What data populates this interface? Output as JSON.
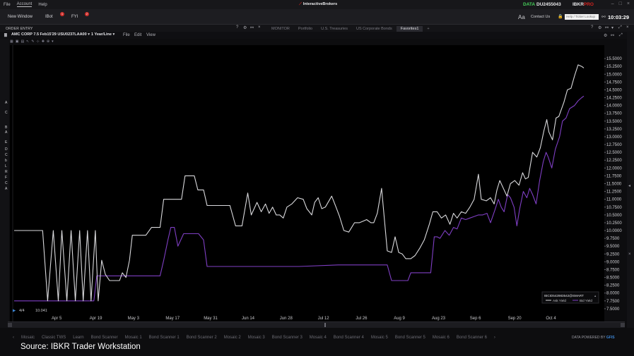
{
  "menu": {
    "items": [
      "File",
      "Account",
      "Help"
    ],
    "active_index": 1
  },
  "brand": "InteractiveBrokers",
  "toolbar": {
    "new_window": "New Window",
    "ibot": "IBot",
    "ibot_badge": "1",
    "fyi": "FYI",
    "fyi_badge": "2",
    "data_label": "DATA",
    "account_id": "DU2455043",
    "ibkr": "IBKR",
    "ibkr_pro": "PRO",
    "font_size_glyph": "Aa",
    "contact": "Contact Us",
    "lookup_placeholder": "Help / Ticker Lookup",
    "clock": "10:03:29"
  },
  "panel": {
    "order_entry": "ORDER ENTRY",
    "tabs": [
      "MONITOR",
      "Portfolio",
      "U.S. Treasuries",
      "US Corporate Bonds",
      "Favorites1"
    ],
    "selected_tab": 4,
    "add_tab": "+"
  },
  "chart_header": {
    "symbol": "AMC CORP 7.5 Feb15'29 USU0237LAA00",
    "period": "1 Year/Line",
    "menus": [
      "File",
      "Edit",
      "View"
    ]
  },
  "left_letters": [
    "A",
    "C",
    "B",
    "A",
    "E",
    "D",
    "C",
    "b",
    "L",
    "R",
    "F",
    "C",
    "A"
  ],
  "bottom_tabs": [
    "Mosaic",
    "Classic TWS",
    "Learn",
    "Bond Scanner",
    "Mosaic 1",
    "Bond Scanner 1",
    "Bond Scanner 2",
    "Mosaic 2",
    "Mosaic 3",
    "Bond Scanner 3",
    "Mosaic 4",
    "Bond Scanner 4",
    "Mosaic 5",
    "Bond Scanner 5",
    "Mosaic 6",
    "Bond Scanner 6"
  ],
  "powered_by": "DATA POWERED BY",
  "powered_brand": "GFIS",
  "source": "Source: IBKR Trader Workstation",
  "colors": {
    "ask": "#d9d9dc",
    "bid": "#7f3fc4",
    "background": "#000000",
    "accent": "#d3231f"
  },
  "chart_data": {
    "type": "line",
    "x_ticks": [
      "Apr 5",
      "Apr 19",
      "May 3",
      "May 17",
      "May 31",
      "Jun 14",
      "Jun 28",
      "Jul 12",
      "Jul 26",
      "Aug 9",
      "Aug 23",
      "Sep 6",
      "Sep 20",
      "Oct 4"
    ],
    "ylim": [
      7.25,
      15.75
    ],
    "y_ticks": [
      "7.5000",
      "7.7500",
      "8.0000",
      "8.2500",
      "8.5000",
      "8.7500",
      "9.0000",
      "9.2500",
      "9.5000",
      "9.7500",
      "10.0000",
      "10.2500",
      "10.5000",
      "10.7500",
      "11.0000",
      "11.2500",
      "11.5000",
      "11.7500",
      "12.0000",
      "12.2500",
      "12.5000",
      "12.7500",
      "13.0000",
      "13.2500",
      "13.5000",
      "13.7500",
      "14.0000",
      "14.2500",
      "14.5000",
      "14.7500",
      "15.0000",
      "15.2500",
      "15.5000"
    ],
    "cursor_readout": {
      "date": "4/4",
      "value": "10.041"
    },
    "instrument_label": "IBCID542983542@SMART",
    "series": [
      {
        "name": "Ask Yield",
        "color": "#d9d9dc",
        "points": [
          [
            0,
            10.0
          ],
          [
            40,
            10.0
          ],
          [
            47,
            7.75
          ],
          [
            55,
            10.0
          ],
          [
            62,
            7.75
          ],
          [
            67,
            10.0
          ],
          [
            74,
            7.75
          ],
          [
            80,
            10.0
          ],
          [
            86,
            7.75
          ],
          [
            92,
            10.0
          ],
          [
            97,
            7.75
          ],
          [
            103,
            10.0
          ],
          [
            108,
            7.75
          ],
          [
            114,
            10.0
          ],
          [
            118,
            7.75
          ],
          [
            123,
            9.05
          ],
          [
            128,
            8.6
          ],
          [
            134,
            8.4
          ],
          [
            148,
            8.4
          ],
          [
            152,
            8.65
          ],
          [
            157,
            8.5
          ],
          [
            162,
            9.05
          ],
          [
            166,
            9.85
          ],
          [
            185,
            9.85
          ],
          [
            193,
            10.1
          ],
          [
            205,
            10.1
          ],
          [
            210,
            11.0
          ],
          [
            226,
            11.0
          ],
          [
            235,
            11.0
          ],
          [
            240,
            11.75
          ],
          [
            253,
            11.75
          ],
          [
            258,
            11.3
          ],
          [
            266,
            11.3
          ],
          [
            271,
            10.8
          ],
          [
            303,
            10.8
          ],
          [
            311,
            10.15
          ],
          [
            320,
            10.15
          ],
          [
            328,
            11.2
          ],
          [
            333,
            10.5
          ],
          [
            341,
            10.9
          ],
          [
            347,
            10.6
          ],
          [
            353,
            10.85
          ],
          [
            358,
            10.55
          ],
          [
            363,
            10.75
          ],
          [
            368,
            10.5
          ],
          [
            373,
            10.5
          ],
          [
            378,
            10.4
          ],
          [
            383,
            10.75
          ],
          [
            390,
            10.85
          ],
          [
            398,
            11.05
          ],
          [
            406,
            11.0
          ],
          [
            411,
            10.7
          ],
          [
            418,
            10.5
          ],
          [
            422,
            10.9
          ],
          [
            427,
            11.05
          ],
          [
            432,
            10.7
          ],
          [
            437,
            10.75
          ],
          [
            446,
            11.1
          ],
          [
            452,
            10.75
          ],
          [
            457,
            10.45
          ],
          [
            463,
            10.0
          ],
          [
            470,
            9.95
          ],
          [
            478,
            10.25
          ],
          [
            485,
            10.25
          ],
          [
            490,
            10.3
          ],
          [
            495,
            10.35
          ],
          [
            501,
            10.25
          ],
          [
            505,
            10.25
          ],
          [
            510,
            10.55
          ],
          [
            516,
            11.35
          ],
          [
            524,
            9.35
          ],
          [
            530,
            9.3
          ],
          [
            535,
            9.8
          ],
          [
            540,
            9.3
          ],
          [
            545,
            9.25
          ],
          [
            550,
            9.1
          ],
          [
            557,
            9.1
          ],
          [
            563,
            9.2
          ],
          [
            570,
            9.45
          ],
          [
            576,
            9.7
          ],
          [
            583,
            10.2
          ],
          [
            588,
            10.6
          ],
          [
            594,
            10.6
          ],
          [
            600,
            10.4
          ],
          [
            606,
            10.5
          ],
          [
            612,
            10.2
          ],
          [
            617,
            10.55
          ],
          [
            622,
            10.4
          ],
          [
            628,
            10.6
          ],
          [
            634,
            10.55
          ],
          [
            640,
            10.75
          ],
          [
            646,
            11.0
          ],
          [
            652,
            11.8
          ],
          [
            656,
            11.0
          ],
          [
            663,
            10.95
          ],
          [
            669,
            11.05
          ],
          [
            674,
            10.85
          ],
          [
            678,
            11.3
          ],
          [
            682,
            11.6
          ],
          [
            687,
            11.35
          ],
          [
            692,
            11.1
          ],
          [
            697,
            11.5
          ],
          [
            703,
            11.6
          ],
          [
            709,
            11.45
          ],
          [
            714,
            11.85
          ],
          [
            718,
            11.65
          ],
          [
            722,
            11.7
          ],
          [
            728,
            12.5
          ],
          [
            734,
            12.35
          ],
          [
            739,
            12.65
          ],
          [
            744,
            13.2
          ],
          [
            748,
            13.55
          ],
          [
            751,
            13.15
          ],
          [
            756,
            12.9
          ],
          [
            761,
            13.6
          ],
          [
            765,
            13.65
          ],
          [
            772,
            14.1
          ],
          [
            777,
            14.5
          ],
          [
            782,
            14.55
          ],
          [
            787,
            14.95
          ],
          [
            792,
            15.3
          ],
          [
            797,
            15.25
          ],
          [
            800,
            15.2
          ]
        ]
      },
      {
        "name": "Bid Yield",
        "color": "#7f3fc4",
        "points": [
          [
            0,
            7.75
          ],
          [
            30,
            7.75
          ],
          [
            112,
            7.75
          ],
          [
            116,
            8.55
          ],
          [
            134,
            8.55
          ],
          [
            205,
            8.55
          ],
          [
            210,
            9.05
          ],
          [
            216,
            9.7
          ],
          [
            220,
            10.1
          ],
          [
            225,
            10.1
          ],
          [
            230,
            9.5
          ],
          [
            238,
            9.9
          ],
          [
            259,
            9.9
          ],
          [
            266,
            9.7
          ],
          [
            271,
            8.85
          ],
          [
            320,
            8.85
          ],
          [
            340,
            8.85
          ],
          [
            400,
            8.85
          ],
          [
            455,
            8.9
          ],
          [
            500,
            8.9
          ],
          [
            524,
            8.9
          ],
          [
            530,
            8.4
          ],
          [
            553,
            8.4
          ],
          [
            557,
            8.65
          ],
          [
            585,
            8.65
          ],
          [
            590,
            9.8
          ],
          [
            594,
            9.8
          ],
          [
            598,
            9.75
          ],
          [
            605,
            10.0
          ],
          [
            611,
            9.85
          ],
          [
            617,
            10.1
          ],
          [
            622,
            10.05
          ],
          [
            628,
            10.4
          ],
          [
            634,
            10.35
          ],
          [
            640,
            10.4
          ],
          [
            646,
            10.45
          ],
          [
            652,
            10.5
          ],
          [
            658,
            10.5
          ],
          [
            664,
            10.55
          ],
          [
            669,
            10.25
          ],
          [
            675,
            10.65
          ],
          [
            680,
            11.0
          ],
          [
            684,
            10.75
          ],
          [
            688,
            10.6
          ],
          [
            693,
            11.15
          ],
          [
            697,
            11.05
          ],
          [
            702,
            10.75
          ],
          [
            706,
            10.15
          ],
          [
            710,
            10.7
          ],
          [
            715,
            11.25
          ],
          [
            720,
            11.05
          ],
          [
            724,
            11.35
          ],
          [
            728,
            11.15
          ],
          [
            733,
            10.85
          ],
          [
            738,
            11.6
          ],
          [
            743,
            12.2
          ],
          [
            747,
            12.5
          ],
          [
            750,
            12.35
          ],
          [
            755,
            12.0
          ],
          [
            760,
            12.6
          ],
          [
            766,
            13.0
          ],
          [
            770,
            13.5
          ],
          [
            775,
            13.6
          ],
          [
            780,
            13.9
          ],
          [
            787,
            14.0
          ],
          [
            792,
            14.15
          ],
          [
            797,
            14.25
          ],
          [
            800,
            14.3
          ]
        ]
      }
    ]
  }
}
